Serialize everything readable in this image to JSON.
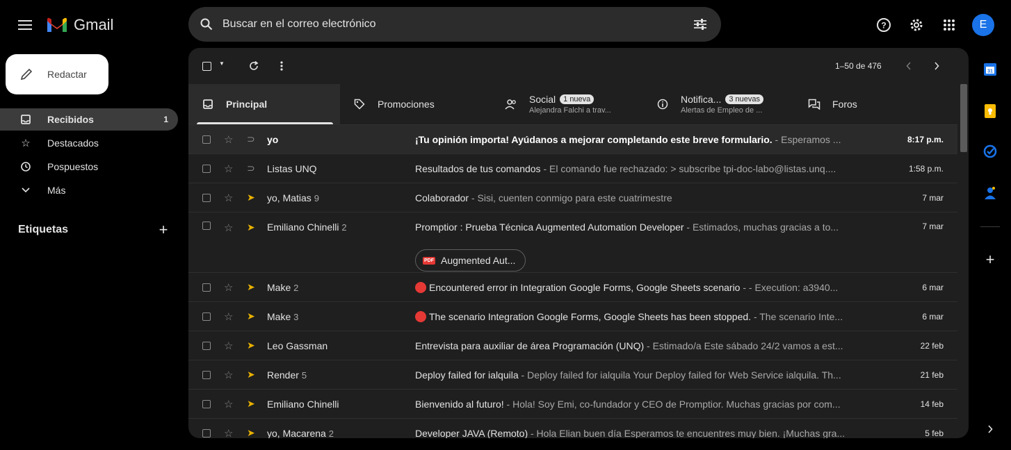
{
  "app": {
    "name": "Gmail"
  },
  "header": {
    "search_placeholder": "Buscar en el correo electrónico",
    "avatar_letter": "E"
  },
  "sidebar": {
    "compose_label": "Redactar",
    "items": [
      {
        "label": "Recibidos",
        "count": "1",
        "icon": "inbox-icon"
      },
      {
        "label": "Destacados",
        "icon": "star-icon"
      },
      {
        "label": "Pospuestos",
        "icon": "clock-icon"
      },
      {
        "label": "Más",
        "icon": "chevron-down-icon"
      }
    ],
    "labels_title": "Etiquetas"
  },
  "toolbar": {
    "range": "1–50 de 476"
  },
  "tabs": [
    {
      "title": "Principal"
    },
    {
      "title": "Promociones"
    },
    {
      "title": "Social",
      "badge": "1 nueva",
      "sub": "Alejandra Falchi a trav..."
    },
    {
      "title": "Notifica...",
      "badge": "3 nuevas",
      "sub": "Alertas de Empleo de ..."
    },
    {
      "title": "Foros"
    }
  ],
  "emails": [
    {
      "sender": "yo",
      "count": "",
      "subject": "¡Tu opinión importa! Ayúdanos a mejorar completando este breve formulario.",
      "snippet": " - Esperamos ...",
      "date": "8:17 p.m.",
      "unread": true,
      "important": false
    },
    {
      "sender": "Listas UNQ",
      "count": "",
      "subject": "Resultados de tus comandos",
      "snippet": " - El comando fue rechazado: > subscribe tpi-doc-labo@listas.unq....",
      "date": "1:58 p.m.",
      "unread": false,
      "important": false
    },
    {
      "sender": "yo, Matias",
      "count": "9",
      "subject": "Colaborador",
      "snippet": " - Sisi, cuenten conmigo para este cuatrimestre",
      "date": "7 mar",
      "unread": false,
      "important": true
    },
    {
      "sender": "Emiliano Chinelli",
      "count": "2",
      "subject": "Promptior : Prueba Técnica Augmented Automation Developer",
      "snippet": " - Estimados, muchas gracias a to...",
      "date": "7 mar",
      "unread": false,
      "important": true,
      "attachment": "Augmented Aut..."
    },
    {
      "sender": "Make",
      "count": "2",
      "subject": "Encountered error in Integration Google Forms, Google Sheets scenario",
      "snippet": " - - Execution: a3940...",
      "date": "6 mar",
      "unread": false,
      "important": true,
      "dot": true
    },
    {
      "sender": "Make",
      "count": "3",
      "subject": "The scenario Integration Google Forms, Google Sheets has been stopped.",
      "snippet": " - The scenario Inte...",
      "date": "6 mar",
      "unread": false,
      "important": true,
      "dot": true
    },
    {
      "sender": "Leo Gassman",
      "count": "",
      "subject": "Entrevista para auxiliar de área Programación (UNQ)",
      "snippet": " - Estimado/a Este sábado 24/2 vamos a est...",
      "date": "22 feb",
      "unread": false,
      "important": true
    },
    {
      "sender": "Render",
      "count": "5",
      "subject": "Deploy failed for ialquila",
      "snippet": " - Deploy failed for ialquila Your Deploy failed for Web Service ialquila. Th...",
      "date": "21 feb",
      "unread": false,
      "important": true
    },
    {
      "sender": "Emiliano Chinelli",
      "count": "",
      "subject": "Bienvenido al futuro!",
      "snippet": " - Hola! Soy Emi, co-fundador y CEO de Promptior. Muchas gracias por com...",
      "date": "14 feb",
      "unread": false,
      "important": true
    },
    {
      "sender": "yo, Macarena",
      "count": "2",
      "subject": "Developer JAVA (Remoto)",
      "snippet": " - Hola Elian buen día Esperamos te encuentres muy bien. ¡Muchas gra...",
      "date": "5 feb",
      "unread": false,
      "important": true
    }
  ],
  "colors": {
    "accent_calendar": "#1a73e8",
    "accent_keep": "#fbbc04",
    "accent_tasks": "#1a73e8",
    "important": "#e8b100"
  }
}
